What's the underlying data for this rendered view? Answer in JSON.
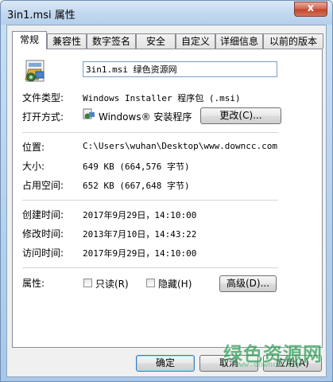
{
  "window": {
    "title": "3in1.msi 属性",
    "close_symbol": "x"
  },
  "tabs": [
    {
      "label": "常规"
    },
    {
      "label": "兼容性"
    },
    {
      "label": "数字签名"
    },
    {
      "label": "安全"
    },
    {
      "label": "自定义"
    },
    {
      "label": "详细信息"
    },
    {
      "label": "以前的版本"
    }
  ],
  "general": {
    "file_name": "3in1.msi 绿色资源网",
    "file_type_label": "文件类型:",
    "file_type_value": "Windows Installer 程序包 (.msi)",
    "open_with_label": "打开方式:",
    "open_with_value": "Windows® 安装程序",
    "change_button": "更改(C)...",
    "location_label": "位置:",
    "location_value": "C:\\Users\\wuhan\\Desktop\\www.downcc.com",
    "size_label": "大小:",
    "size_value": "649 KB (664,576 字节)",
    "size_on_disk_label": "占用空间:",
    "size_on_disk_value": "652 KB (667,648 字节)",
    "created_label": "创建时间:",
    "created_value": "2017年9月29日，14:10:00",
    "modified_label": "修改时间:",
    "modified_value": "2013年7月10日，14:43:22",
    "accessed_label": "访问时间:",
    "accessed_value": "2017年9月29日，14:10:00",
    "attributes_label": "属性:",
    "readonly_label": "只读(R)",
    "hidden_label": "隐藏(H)",
    "advanced_button": "高级(D)..."
  },
  "footer": {
    "ok_button": "确定",
    "cancel_button": "取消",
    "apply_button": "应用(A)"
  },
  "watermark": {
    "text": "绿色资源网",
    "url": "www.downcc.com"
  }
}
